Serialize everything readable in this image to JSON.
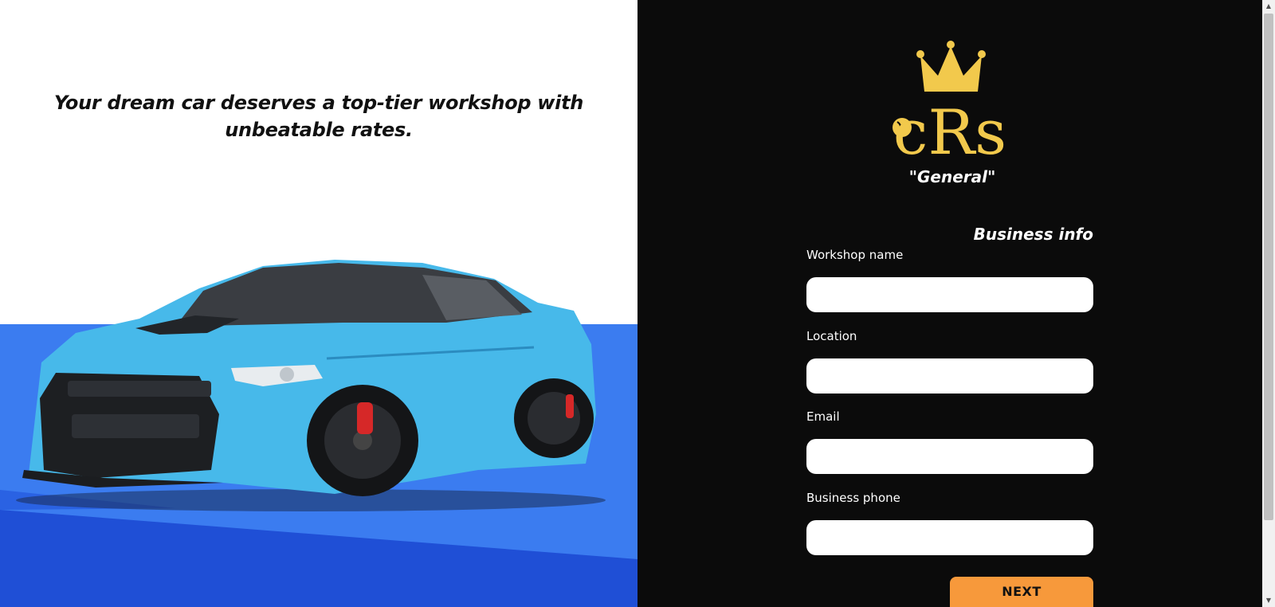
{
  "hero": {
    "tagline": "Your dream car deserves a top-tier workshop with unbeatable rates.",
    "image": "sports-car-photo"
  },
  "brand": {
    "logo_icon": "crown-icon",
    "logo_text": "cRs",
    "tier": "\"General\"",
    "gold": "#f2c94c"
  },
  "form": {
    "title": "Business info",
    "fields": [
      {
        "label": "Workshop name",
        "value": ""
      },
      {
        "label": "Location",
        "value": ""
      },
      {
        "label": "Email",
        "value": ""
      },
      {
        "label": "Business phone",
        "value": ""
      }
    ],
    "next_label": "NEXT"
  },
  "colors": {
    "panel_bg": "#0b0b0b",
    "accent": "#f7993b",
    "hero_blue": "#3b7cf0",
    "car_body": "#47b9ea"
  }
}
